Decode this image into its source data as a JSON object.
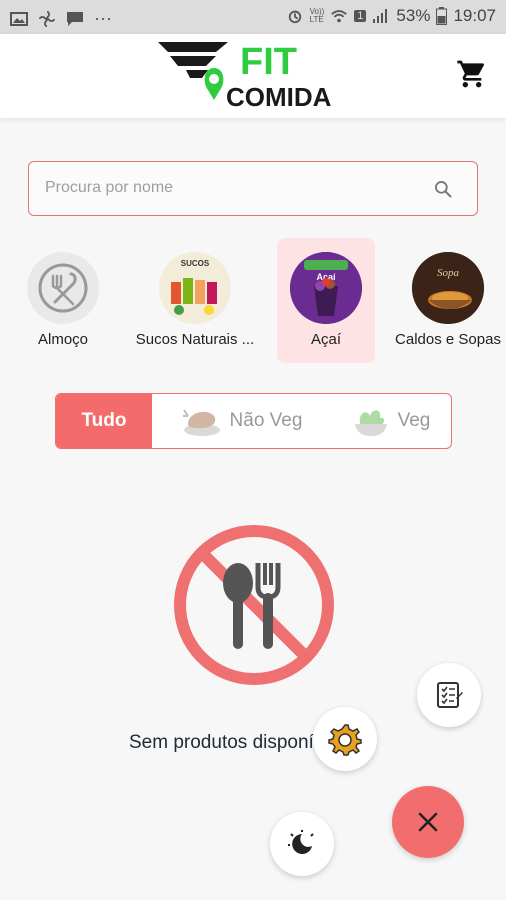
{
  "status_bar": {
    "battery_percent": "53%",
    "time": "19:07",
    "dots": "···",
    "volte": "Vo))",
    "lte": "LTE",
    "sim": "1"
  },
  "header": {
    "logo_text_top": "FIT",
    "logo_text_bottom": "COMIDA",
    "cart_icon": "shopping-cart-icon"
  },
  "search": {
    "placeholder": "Procura por nome",
    "value": ""
  },
  "categories": [
    {
      "label": "Almoço",
      "icon": "no-fork-spoon-icon",
      "selected": false
    },
    {
      "label": "Sucos Naturais ...",
      "icon": "juice-image",
      "thumb_text": "SUCOS",
      "selected": false
    },
    {
      "label": "Açaí",
      "icon": "acai-image",
      "thumb_text": "Açaí",
      "selected": true
    },
    {
      "label": "Caldos e Sopas",
      "icon": "soup-image",
      "thumb_text": "Sopa",
      "selected": false
    }
  ],
  "filters": [
    {
      "label": "Tudo",
      "active": true
    },
    {
      "label": "Não Veg",
      "active": false
    },
    {
      "label": "Veg",
      "active": false
    }
  ],
  "empty_state": {
    "text": "Sem produtos disponíveis"
  },
  "colors": {
    "accent": "#f26d6d",
    "border": "#e57373",
    "logo_green": "#2ecc40",
    "logo_dark": "#1a1a1a"
  }
}
